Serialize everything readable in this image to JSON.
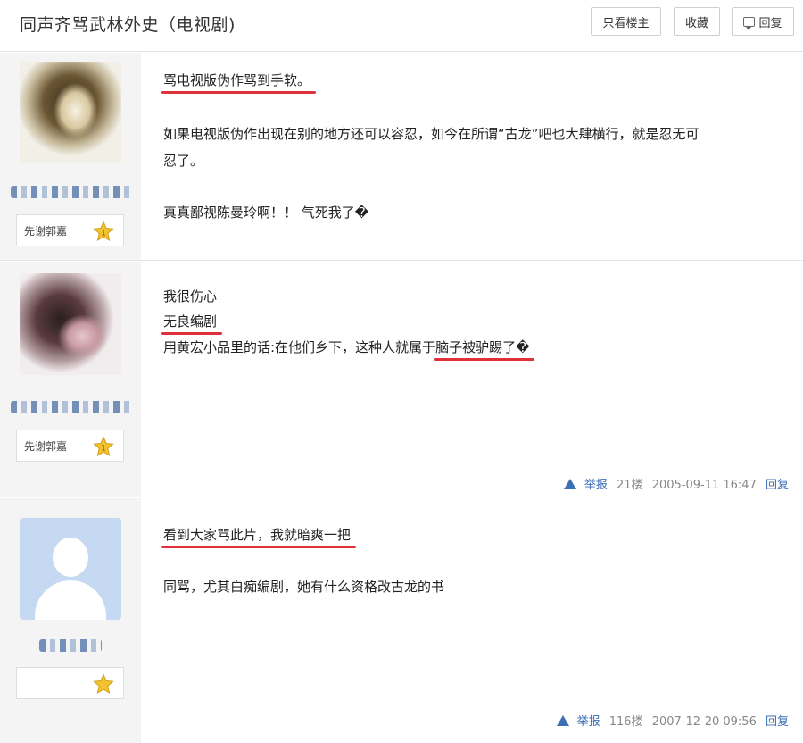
{
  "header": {
    "title": "同声齐骂武林外史（电视剧)",
    "only_op": "只看楼主",
    "favorite": "收藏",
    "reply": "回复"
  },
  "posts": [
    {
      "badge": "先谢郭嘉",
      "badge_level": "1",
      "lines": [
        "骂电视版伪作骂到手软。",
        "如果电视版伪作出现在别的地方还可以容忍，如今在所谓“古龙”吧也大肆横行，就是忍无可",
        "忍了。",
        "真真鄙视陈曼玲啊！！ 气死我了�"
      ]
    },
    {
      "badge": "先谢郭嘉",
      "badge_level": "1",
      "lines": [
        "我很伤心",
        "无良编剧",
        "用黄宏小品里的话:在他们乡下，这种人就属于",
        "脑子被驴踢了�"
      ],
      "report": "举报",
      "floor": "21楼",
      "time": "2005-09-11 16:47",
      "reply": "回复"
    },
    {
      "badge": "",
      "lines": [
        "看到大家骂此片，我就暗爽一把",
        "同骂，尤其白痴编剧，她有什么资格改古龙的书"
      ],
      "report": "举报",
      "floor": "116楼",
      "time": "2007-12-20 09:56",
      "reply": "回复"
    }
  ],
  "colors": {
    "underline": "#e0303a",
    "link": "#3b6fb6",
    "star": "#f3c431"
  },
  "icons": [
    "reply-icon",
    "star-icon",
    "warning-icon"
  ]
}
